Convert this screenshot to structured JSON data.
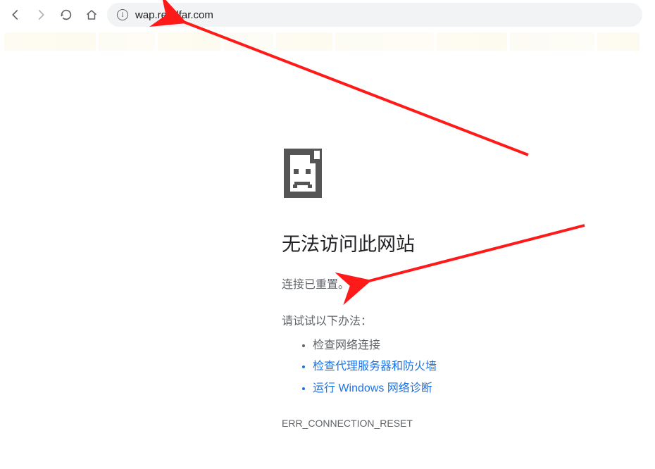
{
  "toolbar": {
    "url": "wap.readfar.com"
  },
  "error": {
    "title": "无法访问此网站",
    "subtitle": "连接已重置。",
    "try_label": "请试试以下办法：",
    "suggestions": {
      "check_connection": "检查网络连接",
      "check_proxy": "检查代理服务器和防火墙",
      "run_diagnostics": "运行 Windows 网络诊断"
    },
    "code": "ERR_CONNECTION_RESET"
  }
}
